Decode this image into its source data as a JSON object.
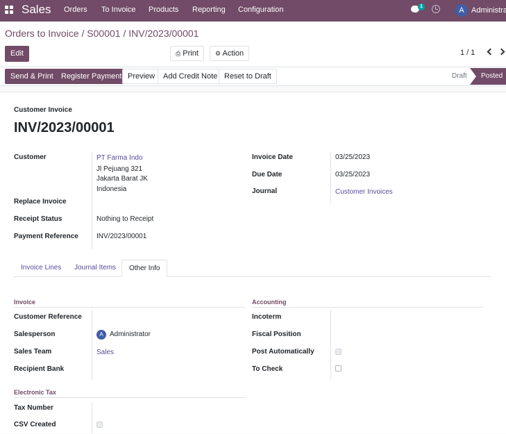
{
  "navbar": {
    "app_title": "Sales",
    "menu": [
      "Orders",
      "To Invoice",
      "Products",
      "Reporting",
      "Configuration"
    ],
    "chat_badge": "1",
    "user_initial": "A",
    "user_name": "Administrat"
  },
  "breadcrumb": {
    "items": [
      "Orders to Invoice",
      "S00001",
      "INV/2023/00001"
    ],
    "separator": "/"
  },
  "toolbar": {
    "edit": "Edit",
    "print": "Print",
    "action": "Action",
    "pager": "1 / 1"
  },
  "status_buttons": {
    "send_print": "Send & Print",
    "register_payment": "Register Payment",
    "preview": "Preview",
    "add_credit_note": "Add Credit Note",
    "reset_to_draft": "Reset to Draft"
  },
  "statusbar": {
    "draft": "Draft",
    "posted": "Posted"
  },
  "invoice": {
    "type_label": "Customer Invoice",
    "number": "INV/2023/00001",
    "customer_label": "Customer",
    "customer_name": "PT Farma Indo",
    "address_line1": "Jl Pejuang 321",
    "address_line2": "Jakarta Barat JK",
    "address_line3": "Indonesia",
    "replace_invoice_label": "Replace Invoice",
    "receipt_status_label": "Receipt Status",
    "receipt_status": "Nothing to Receipt",
    "payment_reference_label": "Payment Reference",
    "payment_reference": "INV/2023/00001",
    "invoice_date_label": "Invoice Date",
    "invoice_date": "03/25/2023",
    "due_date_label": "Due Date",
    "due_date": "03/25/2023",
    "journal_label": "Journal",
    "journal": "Customer Invoices"
  },
  "tabs": [
    "Invoice Lines",
    "Journal Items",
    "Other Info"
  ],
  "other_info": {
    "invoice_section": "Invoice",
    "customer_reference_label": "Customer Reference",
    "salesperson_label": "Salesperson",
    "salesperson_initial": "A",
    "salesperson": "Administrator",
    "sales_team_label": "Sales Team",
    "sales_team": "Sales",
    "recipient_bank_label": "Recipient Bank",
    "accounting_section": "Accounting",
    "incoterm_label": "Incoterm",
    "fiscal_position_label": "Fiscal Position",
    "post_automatically_label": "Post Automatically",
    "to_check_label": "To Check",
    "electronic_tax_section": "Electronic Tax",
    "tax_number_label": "Tax Number",
    "csv_created_label": "CSV Created"
  },
  "colors": {
    "brand": "#714b67",
    "link": "#5a4a9c",
    "avatar": "#3f5da8",
    "chat_badge": "#00a09d"
  },
  "icons": [
    "apps-grid-icon",
    "chat-icon",
    "clock-icon",
    "printer-icon",
    "gear-icon",
    "chevron-left-icon",
    "chevron-right-icon"
  ]
}
